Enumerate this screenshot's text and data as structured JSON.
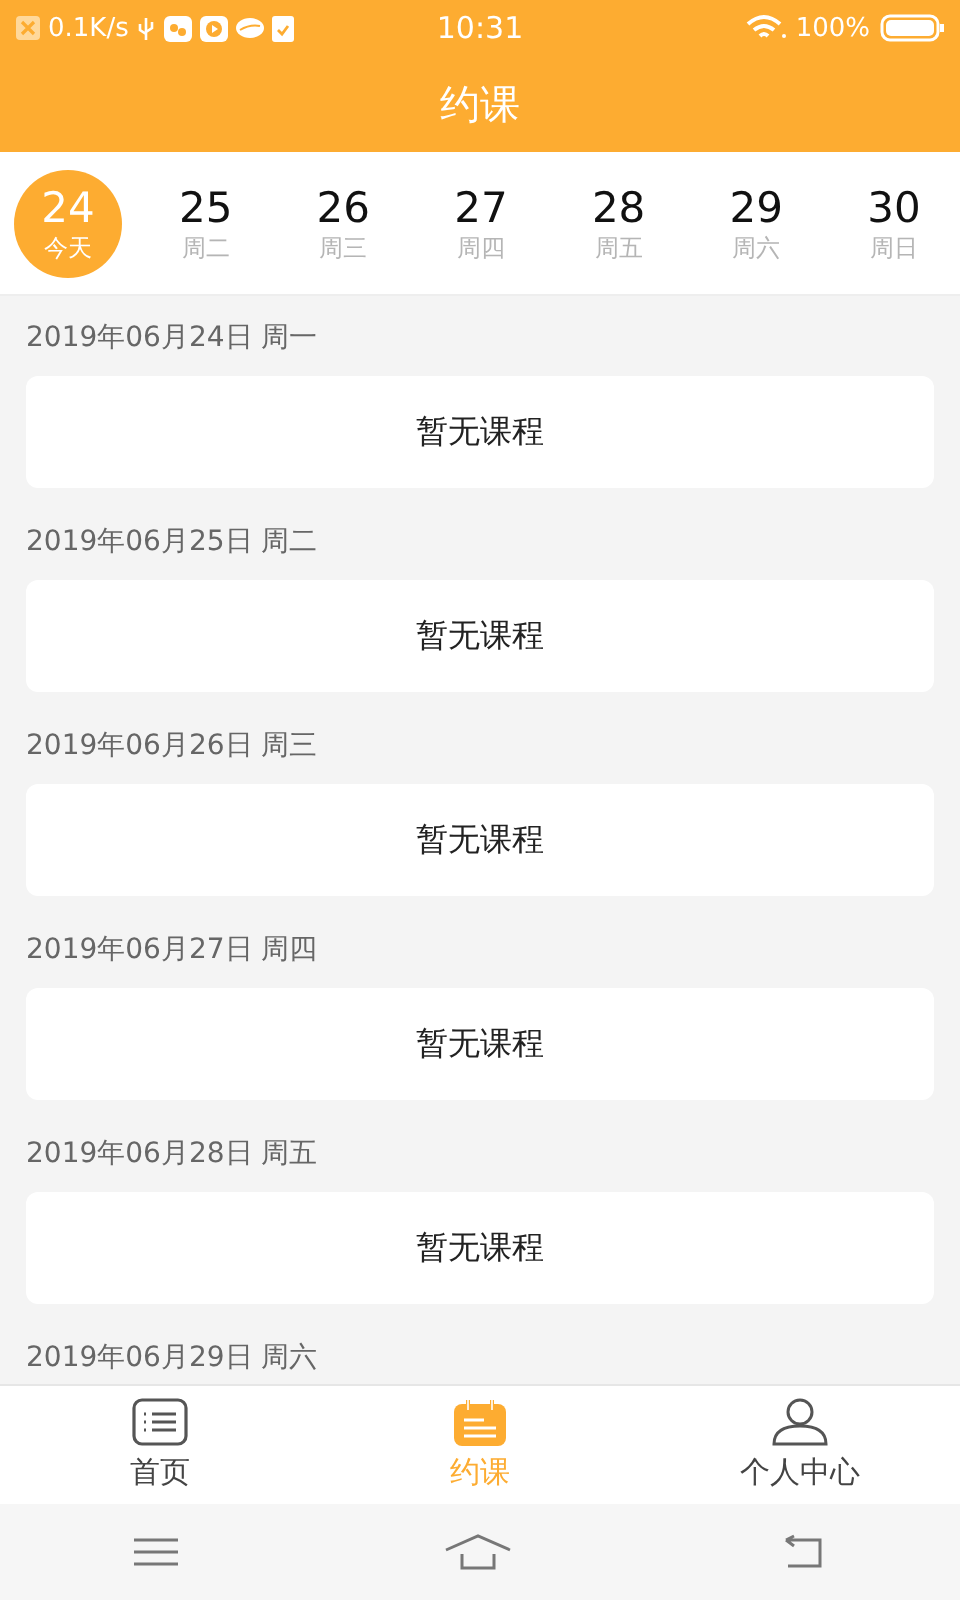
{
  "status_bar": {
    "network_speed": "0.1K/s",
    "time": "10:31",
    "battery": "100%"
  },
  "title": "约课",
  "dates": [
    {
      "day": "24",
      "weekday": "今天",
      "selected": true
    },
    {
      "day": "25",
      "weekday": "周二",
      "selected": false
    },
    {
      "day": "26",
      "weekday": "周三",
      "selected": false
    },
    {
      "day": "27",
      "weekday": "周四",
      "selected": false
    },
    {
      "day": "28",
      "weekday": "周五",
      "selected": false
    },
    {
      "day": "29",
      "weekday": "周六",
      "selected": false
    },
    {
      "day": "30",
      "weekday": "周日",
      "selected": false
    }
  ],
  "schedule": [
    {
      "date": "2019年06月24日 周一",
      "message": "暂无课程"
    },
    {
      "date": "2019年06月25日 周二",
      "message": "暂无课程"
    },
    {
      "date": "2019年06月26日 周三",
      "message": "暂无课程"
    },
    {
      "date": "2019年06月27日 周四",
      "message": "暂无课程"
    },
    {
      "date": "2019年06月28日 周五",
      "message": "暂无课程"
    },
    {
      "date": "2019年06月29日 周六"
    }
  ],
  "tabs": [
    {
      "kind": "home",
      "label": "首页",
      "selected": false
    },
    {
      "kind": "booking",
      "label": "约课",
      "selected": true
    },
    {
      "kind": "profile",
      "label": "个人中心",
      "selected": false
    }
  ]
}
